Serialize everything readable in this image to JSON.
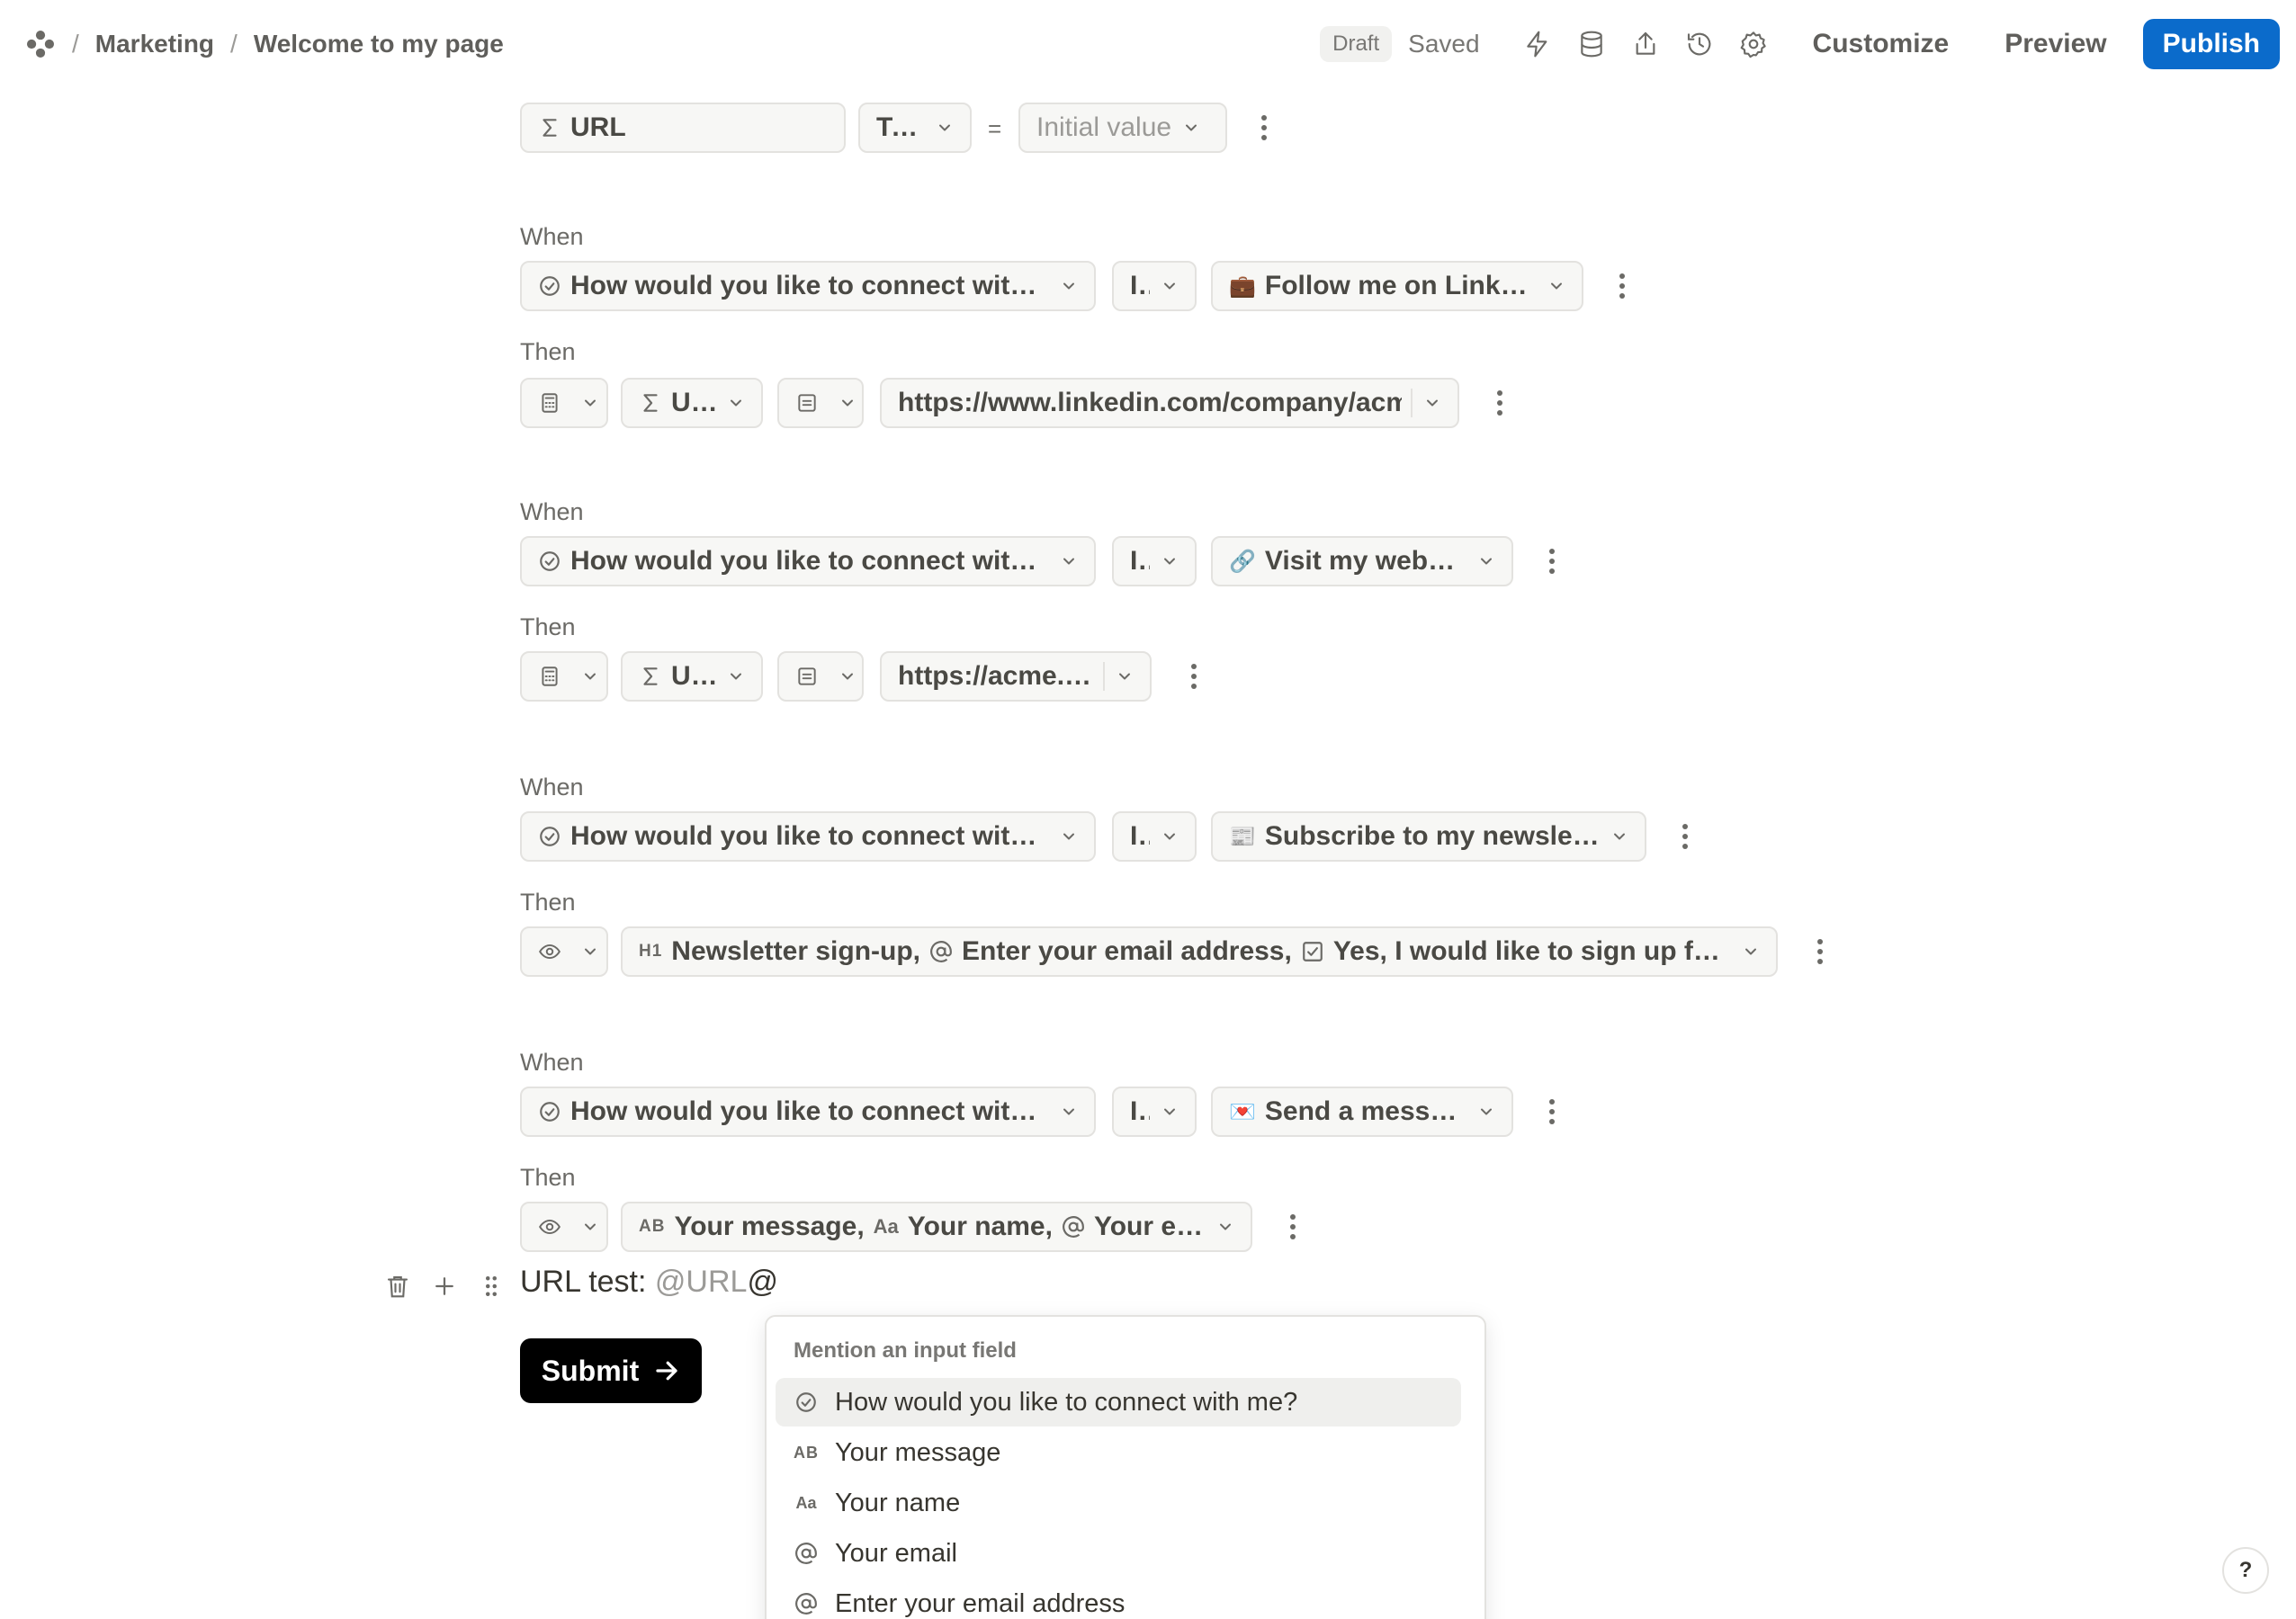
{
  "breadcrumb": [
    "Marketing",
    "Welcome to my page"
  ],
  "header": {
    "draft_badge": "Draft",
    "status": "Saved",
    "customize": "Customize",
    "preview": "Preview",
    "publish": "Publish"
  },
  "colors": {
    "publish": "#0b6bcb",
    "submit": "#000000"
  },
  "variable": {
    "name": "URL",
    "type": "Text",
    "equals": "=",
    "initial_placeholder": "Initial value"
  },
  "rules": [
    {
      "when_label": "When",
      "field": "How would you like to connect with m…",
      "operator": "Is",
      "value_emoji": "💼",
      "value": "Follow me on LinkedIn",
      "then_label": "Then",
      "then_var": "URL",
      "then_value": "https://www.linkedin.com/company/acme"
    },
    {
      "when_label": "When",
      "field": "How would you like to connect with m…",
      "operator": "Is",
      "value_emoji": "🔗",
      "value": "Visit my website",
      "then_label": "Then",
      "then_var": "URL",
      "then_value": "https://acme.inc"
    },
    {
      "when_label": "When",
      "field": "How would you like to connect with m…",
      "operator": "Is",
      "value_emoji": "📰",
      "value": "Subscribe to my newsletter",
      "then_label": "Then",
      "then_fields": [
        {
          "prefix": "H1",
          "label": "Newsletter sign-up,"
        },
        {
          "prefix": "@",
          "label": "Enter your email address,"
        },
        {
          "prefix": "☑",
          "label": "Yes, I would like to sign up for th…"
        }
      ]
    },
    {
      "when_label": "When",
      "field": "How would you like to connect with m…",
      "operator": "Is",
      "value_emoji": "💌",
      "value": "Send a message",
      "then_label": "Then",
      "then_fields": [
        {
          "prefix": "AB",
          "label": "Your message,"
        },
        {
          "prefix": "Aa",
          "label": "Your name,"
        },
        {
          "prefix": "@",
          "label": "Your email"
        }
      ]
    }
  ],
  "block": {
    "text": "URL test: ",
    "mention": "@URL",
    "cursor": "@"
  },
  "submit": "Submit",
  "mention_menu": {
    "title": "Mention an input field",
    "items": [
      {
        "icon": "check-circle-icon",
        "label": "How would you like to connect with me?"
      },
      {
        "icon": "AB",
        "label": "Your message"
      },
      {
        "icon": "Aa",
        "label": "Your name"
      },
      {
        "icon": "at-icon",
        "label": "Your email"
      },
      {
        "icon": "at-icon",
        "label": "Enter your email address"
      }
    ]
  },
  "help": "?"
}
